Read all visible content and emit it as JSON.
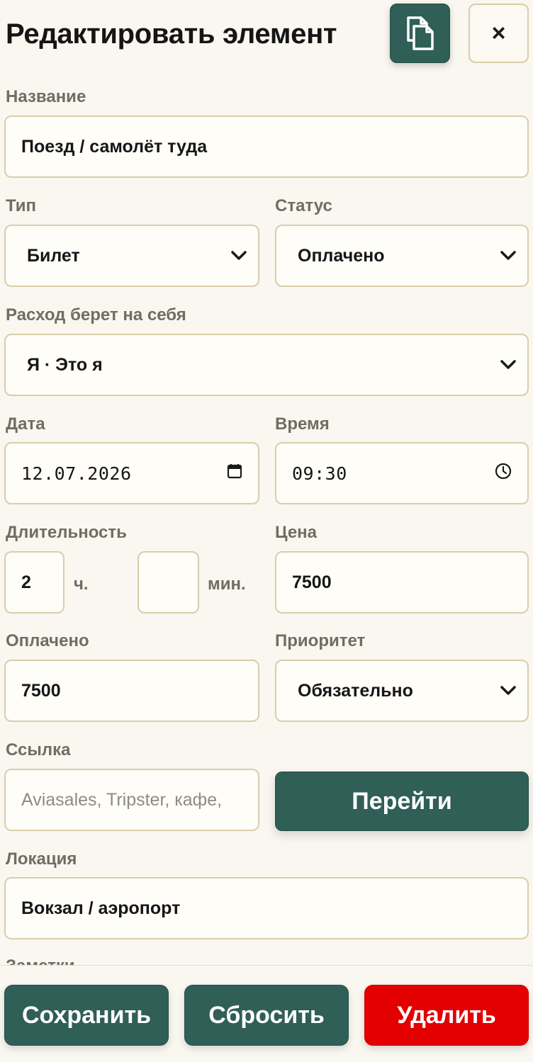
{
  "header": {
    "title": "Редактировать элемент",
    "copy_icon": "copy-icon",
    "close_label": "×"
  },
  "form": {
    "name": {
      "label": "Название",
      "value": "Поезд / самолёт туда"
    },
    "type": {
      "label": "Тип",
      "value": "Билет"
    },
    "status": {
      "label": "Статус",
      "value": "Оплачено"
    },
    "payer": {
      "label": "Расход берет на себя",
      "value": "Я · Это я"
    },
    "date": {
      "label": "Дата",
      "value": "12.07.2026"
    },
    "time": {
      "label": "Время",
      "value": "09:30"
    },
    "duration": {
      "label": "Длительность",
      "hours": "2",
      "hours_unit": "ч.",
      "minutes": "",
      "minutes_unit": "мин."
    },
    "price": {
      "label": "Цена",
      "value": "7500"
    },
    "paid": {
      "label": "Оплачено",
      "value": "7500"
    },
    "priority": {
      "label": "Приоритет",
      "value": "Обязательно"
    },
    "link": {
      "label": "Ссылка",
      "placeholder": "Aviasales, Tripster, кафе,",
      "go_label": "Перейти"
    },
    "location": {
      "label": "Локация",
      "value": "Вокзал / аэропорт"
    },
    "notes": {
      "label": "Заметки"
    }
  },
  "footer": {
    "save_label": "Сохранить",
    "reset_label": "Сбросить",
    "delete_label": "Удалить"
  },
  "colors": {
    "primary": "#2f5f56",
    "danger": "#e30000",
    "border": "#d9cdab",
    "background": "#f9f7f0"
  }
}
